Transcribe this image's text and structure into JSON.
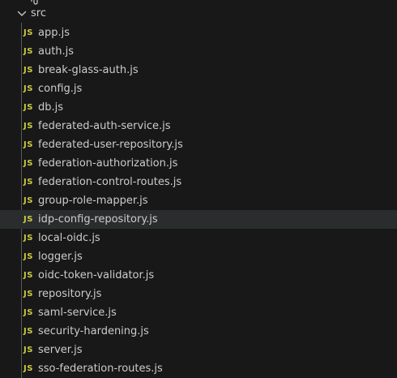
{
  "explorer": {
    "folder": {
      "label": "src",
      "icon": "chevron-down-icon",
      "expanded": true
    },
    "file_icon_label": "JS",
    "file_icon_color": "#cbcb41",
    "selected_file": "idp-config-repository.js",
    "files": [
      "app.js",
      "auth.js",
      "break-glass-auth.js",
      "config.js",
      "db.js",
      "federated-auth-service.js",
      "federated-user-repository.js",
      "federation-authorization.js",
      "federation-control-routes.js",
      "group-role-mapper.js",
      "idp-config-repository.js",
      "local-oidc.js",
      "logger.js",
      "oidc-token-validator.js",
      "repository.js",
      "saml-service.js",
      "security-hardening.js",
      "server.js",
      "sso-federation-routes.js"
    ]
  },
  "colors": {
    "background": "#181818",
    "text": "#cccccc",
    "selected_row": "#2a2d2e",
    "indent_guide": "#585858"
  }
}
